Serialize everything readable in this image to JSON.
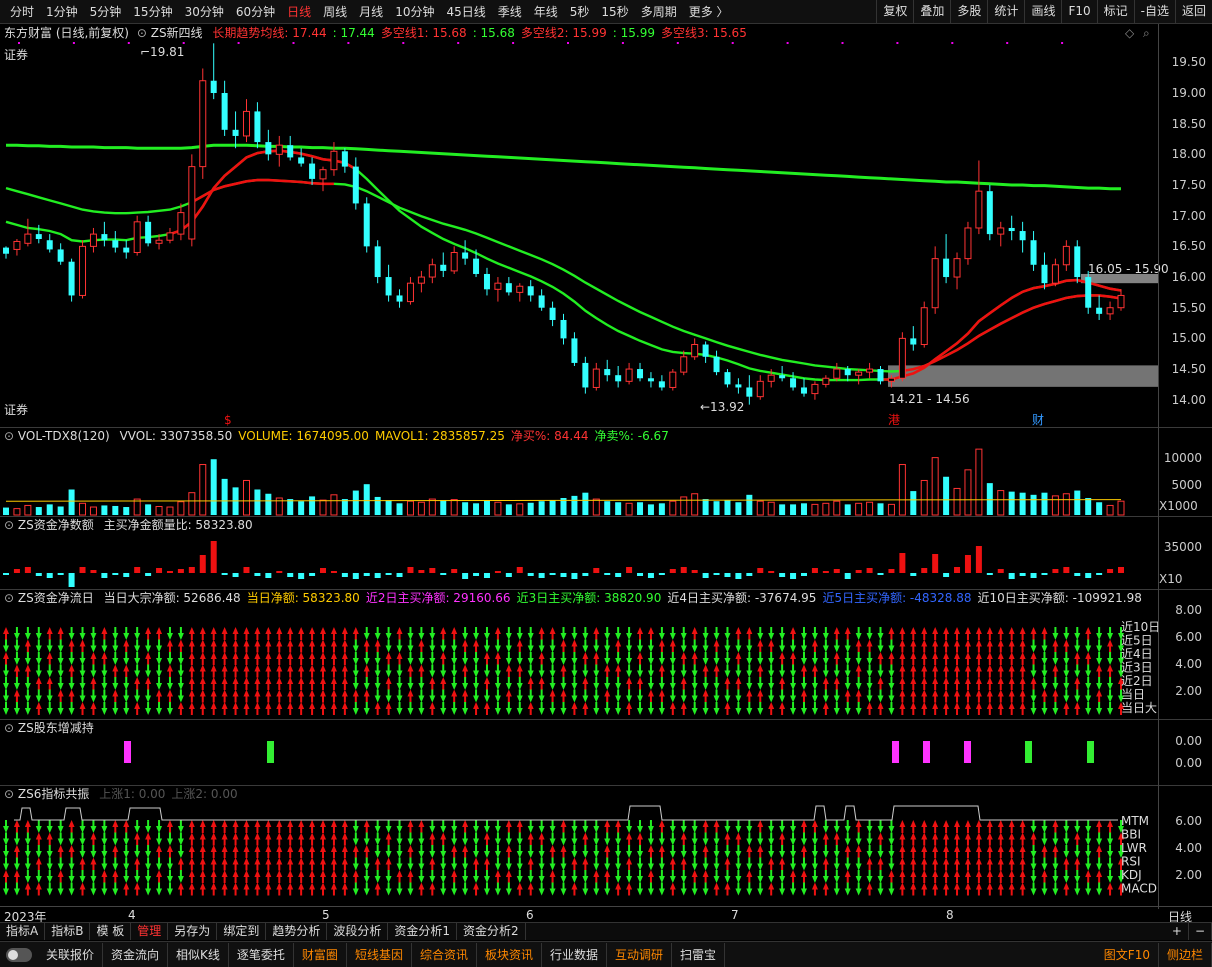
{
  "topbar": {
    "periods": [
      "分时",
      "1分钟",
      "5分钟",
      "15分钟",
      "30分钟",
      "60分钟",
      "日线",
      "周线",
      "月线",
      "10分钟",
      "45日线",
      "季线",
      "年线",
      "5秒",
      "15秒",
      "多周期",
      "更多 〉"
    ],
    "active": "日线",
    "right_tools": [
      "复权",
      "叠加",
      "多股",
      "统计",
      "画线",
      "F10",
      "标记",
      "-自选",
      "返回"
    ]
  },
  "main": {
    "stock": "东方财富 (日线,前复权)",
    "indicator": "ZS新四线",
    "ind_items": [
      {
        "label": "长期趋势均线: 17.44",
        "color": "#ff3333"
      },
      {
        "label": ": 17.44",
        "color": "#33ff33"
      },
      {
        "label": "多空线1: 15.68",
        "color": "#ff3333"
      },
      {
        "label": ": 15.68",
        "color": "#33ff33"
      },
      {
        "label": "多空线2: 15.99",
        "color": "#ff3333"
      },
      {
        "label": ": 15.99",
        "color": "#33ff33"
      },
      {
        "label": "多空线3: 15.65",
        "color": "#ff3333"
      }
    ],
    "tag_top": "证券",
    "tag_bottom": "证券",
    "high_label": "19.81",
    "low_label": "13.92",
    "zone_high": "16.05 - 15.90",
    "zone_low": "14.21 - 14.56",
    "marker_s": "$",
    "marker_gang": "港",
    "marker_cai": "财",
    "price_ticks": [
      "19.50",
      "19.00",
      "18.50",
      "18.00",
      "17.50",
      "17.00",
      "16.50",
      "16.00",
      "15.50",
      "15.00",
      "14.50",
      "14.00"
    ]
  },
  "vol": {
    "title": "VOL-TDX8(120)",
    "items": [
      {
        "label": "VVOL: 3307358.50",
        "color": "#dddddd"
      },
      {
        "label": "VOLUME: 1674095.00",
        "color": "#ffcc00"
      },
      {
        "label": "MAVOL1: 2835857.25",
        "color": "#ffcc00"
      },
      {
        "label": "净买%: 84.44",
        "color": "#ff3333"
      },
      {
        "label": "净卖%: -6.67",
        "color": "#33ff33"
      }
    ],
    "ticks": [
      "10000",
      "5000"
    ],
    "unit": "X1000"
  },
  "flow": {
    "title": "ZS资金净数额",
    "items": [
      {
        "label": "主买净金额量比: 58323.80",
        "color": "#dddddd"
      }
    ],
    "ticks": [
      "35000"
    ],
    "unit": "X10"
  },
  "fund": {
    "title": "ZS资金净流日",
    "items": [
      {
        "label": "当日大宗净额: 52686.48",
        "color": "#dddddd"
      },
      {
        "label": "当日净额: 58323.80",
        "color": "#ffcc00"
      },
      {
        "label": "近2日主买净额: 29160.66",
        "color": "#ff33ff"
      },
      {
        "label": "近3日主买净额: 38820.90",
        "color": "#33ff33"
      },
      {
        "label": "近4日主买净额: -37674.95",
        "color": "#dddddd"
      },
      {
        "label": "近5日主买净额: -48328.88",
        "color": "#3366ff"
      },
      {
        "label": "近10日主买净额: -109921.98",
        "color": "#dddddd"
      }
    ],
    "ticks": [
      "8.00",
      "6.00",
      "4.00",
      "2.00"
    ],
    "row_labels": [
      "近10日",
      "近5日",
      "近4日",
      "近3日",
      "近2日",
      "当日",
      "当日大"
    ]
  },
  "holder": {
    "title": "ZS股东增减持",
    "ticks": [
      "0.00",
      "0.00"
    ]
  },
  "res": {
    "title": "ZS6指标共振",
    "items": [
      {
        "label": "上涨1: 0.00",
        "color": "#555555"
      },
      {
        "label": "上涨2: 0.00",
        "color": "#555555"
      }
    ],
    "ticks": [
      "6.00",
      "4.00",
      "2.00"
    ],
    "row_labels": [
      "MTM",
      "BBI",
      "LWR",
      "RSI",
      "KDJ",
      "MACD"
    ]
  },
  "dates": [
    "2023年",
    "4",
    "5",
    "6",
    "7",
    "8"
  ],
  "period_label": "日线",
  "indicator_tabs": [
    "指标A",
    "指标B",
    "模 板",
    "管理",
    "另存为",
    "绑定到",
    "趋势分析",
    "波段分析",
    "资金分析1",
    "资金分析2"
  ],
  "indicator_active": "管理",
  "indicator_tools": [
    "+",
    "−"
  ],
  "bottom_tabs": [
    {
      "label": "关联报价",
      "hl": false
    },
    {
      "label": "资金流向",
      "hl": false
    },
    {
      "label": "相似K线",
      "hl": false
    },
    {
      "label": "逐笔委托",
      "hl": false
    },
    {
      "label": "财富圈",
      "hl": true
    },
    {
      "label": "短线基因",
      "hl": true
    },
    {
      "label": "综合资讯",
      "hl": true
    },
    {
      "label": "板块资讯",
      "hl": true
    },
    {
      "label": "行业数据",
      "hl": false
    },
    {
      "label": "互动调研",
      "hl": true
    },
    {
      "label": "扫雷宝",
      "hl": false
    }
  ],
  "bottom_right": [
    "图文F10",
    "侧边栏"
  ],
  "colors": {
    "up": "#ff3333",
    "down": "#33ffff",
    "green": "#22ee22",
    "red": "#ee1111",
    "axis": "#444444"
  },
  "chart_data": {
    "type": "candlestick",
    "ylim": [
      13.8,
      19.75
    ],
    "ohlc": [
      [
        16.48,
        16.5,
        16.3,
        16.38
      ],
      [
        16.45,
        16.62,
        16.35,
        16.58
      ],
      [
        16.55,
        16.95,
        16.5,
        16.7
      ],
      [
        16.7,
        16.85,
        16.55,
        16.62
      ],
      [
        16.6,
        16.7,
        16.4,
        16.45
      ],
      [
        16.45,
        16.55,
        16.2,
        16.25
      ],
      [
        16.25,
        16.3,
        15.6,
        15.7
      ],
      [
        15.7,
        16.6,
        15.65,
        16.5
      ],
      [
        16.5,
        16.8,
        16.4,
        16.7
      ],
      [
        16.7,
        16.9,
        16.5,
        16.6
      ],
      [
        16.6,
        16.75,
        16.4,
        16.48
      ],
      [
        16.48,
        16.6,
        16.3,
        16.4
      ],
      [
        16.4,
        17.0,
        16.35,
        16.9
      ],
      [
        16.9,
        17.0,
        16.5,
        16.55
      ],
      [
        16.55,
        16.7,
        16.45,
        16.6
      ],
      [
        16.6,
        16.8,
        16.55,
        16.72
      ],
      [
        16.7,
        17.2,
        16.6,
        17.05
      ],
      [
        16.62,
        18.0,
        16.5,
        17.8
      ],
      [
        17.8,
        19.4,
        17.6,
        19.2
      ],
      [
        19.2,
        19.81,
        18.9,
        19.0
      ],
      [
        19.0,
        19.2,
        18.3,
        18.4
      ],
      [
        18.4,
        18.7,
        18.1,
        18.3
      ],
      [
        18.3,
        18.9,
        18.2,
        18.7
      ],
      [
        18.7,
        18.85,
        18.1,
        18.2
      ],
      [
        18.2,
        18.4,
        17.9,
        18.0
      ],
      [
        18.0,
        18.3,
        17.8,
        18.15
      ],
      [
        18.15,
        18.3,
        17.9,
        17.95
      ],
      [
        17.95,
        18.1,
        17.8,
        17.85
      ],
      [
        17.85,
        17.95,
        17.5,
        17.6
      ],
      [
        17.6,
        17.8,
        17.4,
        17.75
      ],
      [
        17.75,
        18.2,
        17.65,
        18.05
      ],
      [
        18.05,
        18.1,
        17.7,
        17.8
      ],
      [
        17.8,
        17.95,
        17.1,
        17.2
      ],
      [
        17.2,
        17.3,
        16.4,
        16.5
      ],
      [
        16.5,
        16.6,
        15.9,
        16.0
      ],
      [
        16.0,
        16.2,
        15.6,
        15.7
      ],
      [
        15.7,
        15.8,
        15.5,
        15.6
      ],
      [
        15.6,
        16.0,
        15.55,
        15.9
      ],
      [
        15.9,
        16.1,
        15.75,
        16.0
      ],
      [
        16.0,
        16.3,
        15.9,
        16.2
      ],
      [
        16.2,
        16.4,
        16.0,
        16.1
      ],
      [
        16.1,
        16.5,
        16.05,
        16.4
      ],
      [
        16.4,
        16.6,
        16.2,
        16.3
      ],
      [
        16.3,
        16.45,
        16.0,
        16.05
      ],
      [
        16.05,
        16.15,
        15.7,
        15.8
      ],
      [
        15.8,
        16.0,
        15.6,
        15.9
      ],
      [
        15.9,
        16.0,
        15.7,
        15.75
      ],
      [
        15.75,
        15.9,
        15.6,
        15.85
      ],
      [
        15.85,
        15.95,
        15.6,
        15.7
      ],
      [
        15.7,
        15.8,
        15.45,
        15.5
      ],
      [
        15.5,
        15.6,
        15.2,
        15.3
      ],
      [
        15.3,
        15.4,
        14.9,
        15.0
      ],
      [
        15.0,
        15.1,
        14.55,
        14.6
      ],
      [
        14.6,
        14.7,
        14.1,
        14.2
      ],
      [
        14.2,
        14.6,
        14.15,
        14.5
      ],
      [
        14.5,
        14.65,
        14.3,
        14.4
      ],
      [
        14.4,
        14.55,
        14.2,
        14.3
      ],
      [
        14.3,
        14.6,
        14.25,
        14.5
      ],
      [
        14.5,
        14.6,
        14.3,
        14.35
      ],
      [
        14.35,
        14.45,
        14.2,
        14.3
      ],
      [
        14.3,
        14.4,
        14.15,
        14.2
      ],
      [
        14.2,
        14.5,
        14.15,
        14.45
      ],
      [
        14.45,
        14.8,
        14.4,
        14.7
      ],
      [
        14.7,
        15.0,
        14.65,
        14.9
      ],
      [
        14.9,
        14.95,
        14.6,
        14.7
      ],
      [
        14.7,
        14.8,
        14.4,
        14.45
      ],
      [
        14.45,
        14.5,
        14.2,
        14.25
      ],
      [
        14.25,
        14.35,
        14.1,
        14.2
      ],
      [
        14.2,
        14.4,
        13.92,
        14.05
      ],
      [
        14.05,
        14.4,
        14.0,
        14.3
      ],
      [
        14.3,
        14.5,
        14.2,
        14.4
      ],
      [
        14.4,
        14.55,
        14.3,
        14.35
      ],
      [
        14.35,
        14.45,
        14.15,
        14.2
      ],
      [
        14.2,
        14.35,
        14.05,
        14.1
      ],
      [
        14.1,
        14.3,
        14.0,
        14.25
      ],
      [
        14.25,
        14.4,
        14.2,
        14.35
      ],
      [
        14.35,
        14.6,
        14.3,
        14.5
      ],
      [
        14.5,
        14.55,
        14.3,
        14.4
      ],
      [
        14.4,
        14.5,
        14.25,
        14.45
      ],
      [
        14.45,
        14.6,
        14.35,
        14.5
      ],
      [
        14.5,
        14.55,
        14.25,
        14.3
      ],
      [
        14.3,
        14.4,
        14.2,
        14.35
      ],
      [
        14.35,
        15.1,
        14.3,
        15.0
      ],
      [
        15.0,
        15.2,
        14.8,
        14.9
      ],
      [
        14.9,
        15.6,
        14.85,
        15.5
      ],
      [
        15.5,
        16.5,
        15.4,
        16.3
      ],
      [
        16.3,
        16.7,
        15.9,
        16.0
      ],
      [
        16.0,
        16.4,
        15.8,
        16.3
      ],
      [
        16.3,
        16.9,
        16.2,
        16.8
      ],
      [
        16.8,
        17.9,
        16.7,
        17.4
      ],
      [
        17.4,
        17.5,
        16.6,
        16.7
      ],
      [
        16.7,
        16.9,
        16.5,
        16.8
      ],
      [
        16.8,
        17.0,
        16.6,
        16.75
      ],
      [
        16.75,
        16.9,
        16.4,
        16.6
      ],
      [
        16.6,
        16.75,
        16.1,
        16.2
      ],
      [
        16.2,
        16.4,
        15.8,
        15.9
      ],
      [
        15.9,
        16.3,
        15.85,
        16.2
      ],
      [
        16.2,
        16.6,
        16.1,
        16.5
      ],
      [
        16.5,
        16.6,
        15.9,
        16.0
      ],
      [
        16.0,
        16.1,
        15.4,
        15.5
      ],
      [
        15.5,
        15.7,
        15.3,
        15.4
      ],
      [
        15.4,
        15.6,
        15.3,
        15.5
      ],
      [
        15.5,
        15.8,
        15.45,
        15.7
      ]
    ],
    "ma_long": [
      18.15,
      18.15,
      18.14,
      18.14,
      18.13,
      18.13,
      18.12,
      18.12,
      18.12,
      18.11,
      18.11,
      18.11,
      18.1,
      18.1,
      18.1,
      18.1,
      18.1,
      18.11,
      18.13,
      18.15,
      18.15,
      18.15,
      18.15,
      18.14,
      18.13,
      18.13,
      18.12,
      18.12,
      18.11,
      18.11,
      18.1,
      18.1,
      18.09,
      18.08,
      18.07,
      18.06,
      18.05,
      18.04,
      18.03,
      18.02,
      18.01,
      18.0,
      17.99,
      17.98,
      17.97,
      17.96,
      17.95,
      17.94,
      17.93,
      17.92,
      17.91,
      17.9,
      17.89,
      17.88,
      17.87,
      17.86,
      17.85,
      17.84,
      17.83,
      17.82,
      17.81,
      17.8,
      17.79,
      17.78,
      17.77,
      17.76,
      17.75,
      17.74,
      17.73,
      17.72,
      17.71,
      17.7,
      17.69,
      17.68,
      17.67,
      17.66,
      17.65,
      17.64,
      17.63,
      17.62,
      17.61,
      17.6,
      17.59,
      17.58,
      17.57,
      17.56,
      17.55,
      17.55,
      17.54,
      17.53,
      17.52,
      17.51,
      17.5,
      17.5,
      17.49,
      17.49,
      17.48,
      17.47,
      17.46,
      17.45,
      17.45,
      17.44,
      17.44
    ],
    "ma_mid": [
      17.45,
      17.4,
      17.35,
      17.3,
      17.25,
      17.2,
      17.15,
      17.1,
      17.07,
      17.05,
      17.04,
      17.04,
      17.05,
      17.06,
      17.08,
      17.1,
      17.15,
      17.22,
      17.32,
      17.42,
      17.48,
      17.52,
      17.56,
      17.58,
      17.58,
      17.57,
      17.56,
      17.55,
      17.53,
      17.52,
      17.52,
      17.51,
      17.47,
      17.4,
      17.31,
      17.22,
      17.13,
      17.06,
      16.99,
      16.93,
      16.87,
      16.82,
      16.77,
      16.71,
      16.64,
      16.57,
      16.5,
      16.43,
      16.36,
      16.29,
      16.21,
      16.12,
      16.02,
      15.91,
      15.81,
      15.71,
      15.61,
      15.52,
      15.43,
      15.35,
      15.27,
      15.19,
      15.12,
      15.06,
      15.0,
      14.94,
      14.88,
      14.83,
      14.78,
      14.73,
      14.69,
      14.65,
      14.62,
      14.59,
      14.56,
      14.54,
      14.52,
      14.5,
      14.49,
      14.48,
      14.47,
      14.46,
      14.47,
      14.5,
      14.55,
      14.63,
      14.72,
      14.81,
      14.92,
      15.04,
      15.14,
      15.24,
      15.33,
      15.42,
      15.5,
      15.56,
      15.61,
      15.66,
      15.69,
      15.7,
      15.7,
      15.68,
      15.65
    ],
    "ma_short": [
      16.9,
      16.85,
      16.8,
      16.78,
      16.75,
      16.7,
      16.6,
      16.58,
      16.6,
      16.61,
      16.61,
      16.6,
      16.64,
      16.65,
      16.67,
      16.7,
      16.76,
      16.9,
      17.15,
      17.45,
      17.65,
      17.8,
      17.95,
      18.02,
      18.05,
      18.06,
      18.04,
      18.01,
      17.97,
      17.92,
      17.9,
      17.86,
      17.76,
      17.6,
      17.42,
      17.25,
      17.08,
      16.95,
      16.82,
      16.72,
      16.62,
      16.54,
      16.47,
      16.39,
      16.3,
      16.22,
      16.15,
      16.08,
      16.01,
      15.93,
      15.84,
      15.73,
      15.6,
      15.45,
      15.33,
      15.22,
      15.12,
      15.04,
      14.96,
      14.89,
      14.82,
      14.78,
      14.76,
      14.75,
      14.73,
      14.69,
      14.64,
      14.58,
      14.51,
      14.47,
      14.44,
      14.41,
      14.38,
      14.35,
      14.33,
      14.32,
      14.32,
      14.32,
      14.32,
      14.33,
      14.33,
      14.33,
      14.38,
      14.43,
      14.52,
      14.66,
      14.79,
      14.92,
      15.08,
      15.28,
      15.41,
      15.54,
      15.66,
      15.76,
      15.82,
      15.85,
      15.89,
      15.94,
      15.95,
      15.91,
      15.86,
      15.81,
      15.78
    ],
    "vol": [
      1.4,
      1.2,
      1.8,
      1.5,
      2.0,
      1.6,
      4.8,
      2.2,
      1.5,
      1.8,
      1.7,
      1.5,
      3.0,
      2.0,
      1.6,
      1.5,
      2.5,
      4.2,
      9.5,
      10.5,
      6.8,
      5.2,
      6.5,
      4.8,
      4.0,
      3.2,
      3.0,
      2.6,
      3.5,
      2.8,
      3.8,
      3.0,
      4.6,
      5.8,
      3.4,
      2.8,
      2.2,
      2.6,
      2.4,
      3.0,
      2.8,
      2.9,
      2.4,
      2.2,
      2.8,
      2.4,
      2.0,
      2.1,
      2.3,
      2.6,
      2.8,
      3.2,
      3.6,
      4.2,
      3.0,
      2.6,
      2.4,
      2.2,
      2.4,
      2.0,
      2.2,
      2.6,
      3.4,
      4.0,
      3.0,
      2.6,
      2.8,
      2.4,
      3.8,
      2.6,
      2.4,
      2.0,
      2.0,
      2.2,
      2.0,
      2.2,
      2.6,
      2.0,
      2.2,
      2.4,
      2.2,
      2.0,
      9.5,
      4.5,
      6.5,
      10.8,
      7.2,
      5.0,
      8.5,
      12.4,
      6.0,
      4.6,
      4.4,
      4.2,
      3.8,
      4.2,
      3.6,
      4.0,
      4.6,
      3.2,
      2.4,
      1.8,
      2.6
    ]
  }
}
